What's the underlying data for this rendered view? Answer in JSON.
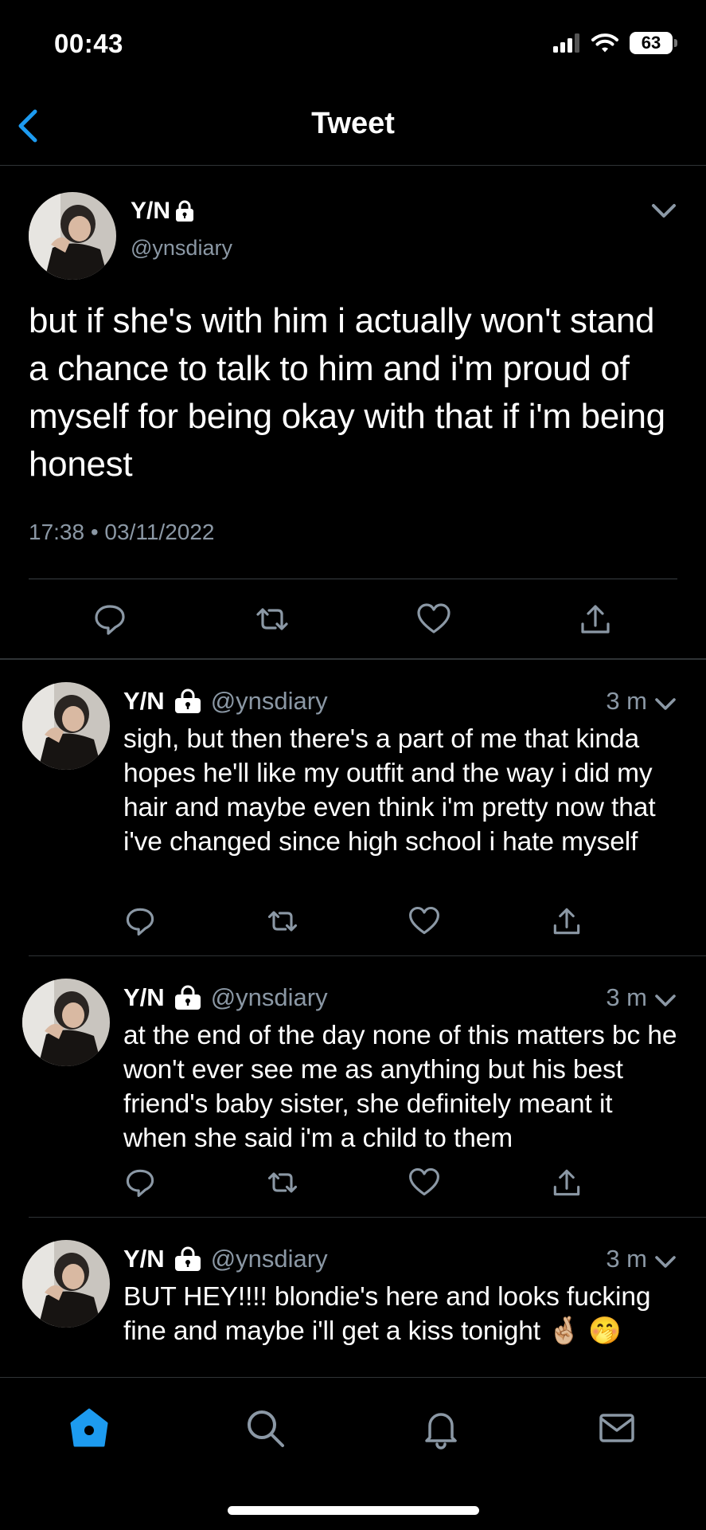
{
  "status_bar": {
    "time": "00:43",
    "battery": "63"
  },
  "header": {
    "title": "Tweet"
  },
  "main_tweet": {
    "name": "Y/N",
    "handle": "@ynsdiary",
    "text": "but if she's with him i actually won't stand a chance to talk to him and i'm proud of myself for being okay with that if i'm being honest",
    "timestamp": "17:38 • 03/11/2022"
  },
  "replies": [
    {
      "name": "Y/N",
      "handle": "@ynsdiary",
      "time": "3 m",
      "text": "sigh, but then there's a part of me that kinda hopes he'll like my outfit and the way i did my hair and maybe even think i'm pretty now that i've changed since high school i hate myself"
    },
    {
      "name": "Y/N",
      "handle": "@ynsdiary",
      "time": "3 m",
      "text": "at the end of the day none of this matters bc he won't ever see me as anything but his best friend's baby sister, she definitely meant it when she said i'm a child to them"
    },
    {
      "name": "Y/N",
      "handle": "@ynsdiary",
      "time": "3 m",
      "text": "BUT HEY!!!! blondie's here and looks fucking fine and maybe i'll get a kiss tonight 🤞🏼 🤭"
    }
  ],
  "colors": {
    "accent": "#1d9bf0",
    "muted": "#8b98a5",
    "divider": "#2f3336"
  },
  "icons": {
    "actions": [
      "reply-icon",
      "retweet-icon",
      "like-icon",
      "share-icon"
    ],
    "tabs": [
      "home-icon",
      "search-icon",
      "notifications-icon",
      "messages-icon"
    ]
  }
}
